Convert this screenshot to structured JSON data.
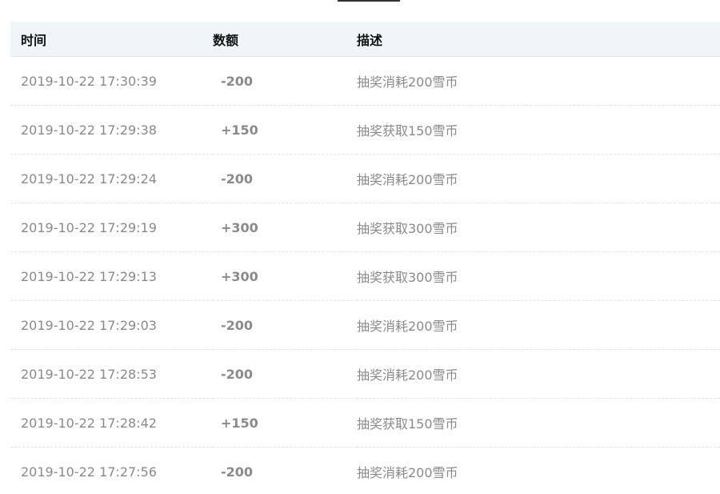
{
  "table": {
    "headers": {
      "time": "时间",
      "amount": "数额",
      "description": "描述"
    },
    "rows": [
      {
        "time": "2019-10-22 17:30:39",
        "amount": "-200",
        "description": "抽奖消耗200雪币"
      },
      {
        "time": "2019-10-22 17:29:38",
        "amount": "+150",
        "description": "抽奖获取150雪币"
      },
      {
        "time": "2019-10-22 17:29:24",
        "amount": "-200",
        "description": "抽奖消耗200雪币"
      },
      {
        "time": "2019-10-22 17:29:19",
        "amount": "+300",
        "description": "抽奖获取300雪币"
      },
      {
        "time": "2019-10-22 17:29:13",
        "amount": "+300",
        "description": "抽奖获取300雪币"
      },
      {
        "time": "2019-10-22 17:29:03",
        "amount": "-200",
        "description": "抽奖消耗200雪币"
      },
      {
        "time": "2019-10-22 17:28:53",
        "amount": "-200",
        "description": "抽奖消耗200雪币"
      },
      {
        "time": "2019-10-22 17:28:42",
        "amount": "+150",
        "description": "抽奖获取150雪币"
      },
      {
        "time": "2019-10-22 17:27:56",
        "amount": "-200",
        "description": "抽奖消耗200雪币"
      }
    ]
  },
  "colors": {
    "negative": "#b5283a",
    "positive": "#1f7a2a",
    "header_bg": "#f0f5f7",
    "muted_text": "#8a8a8a"
  }
}
